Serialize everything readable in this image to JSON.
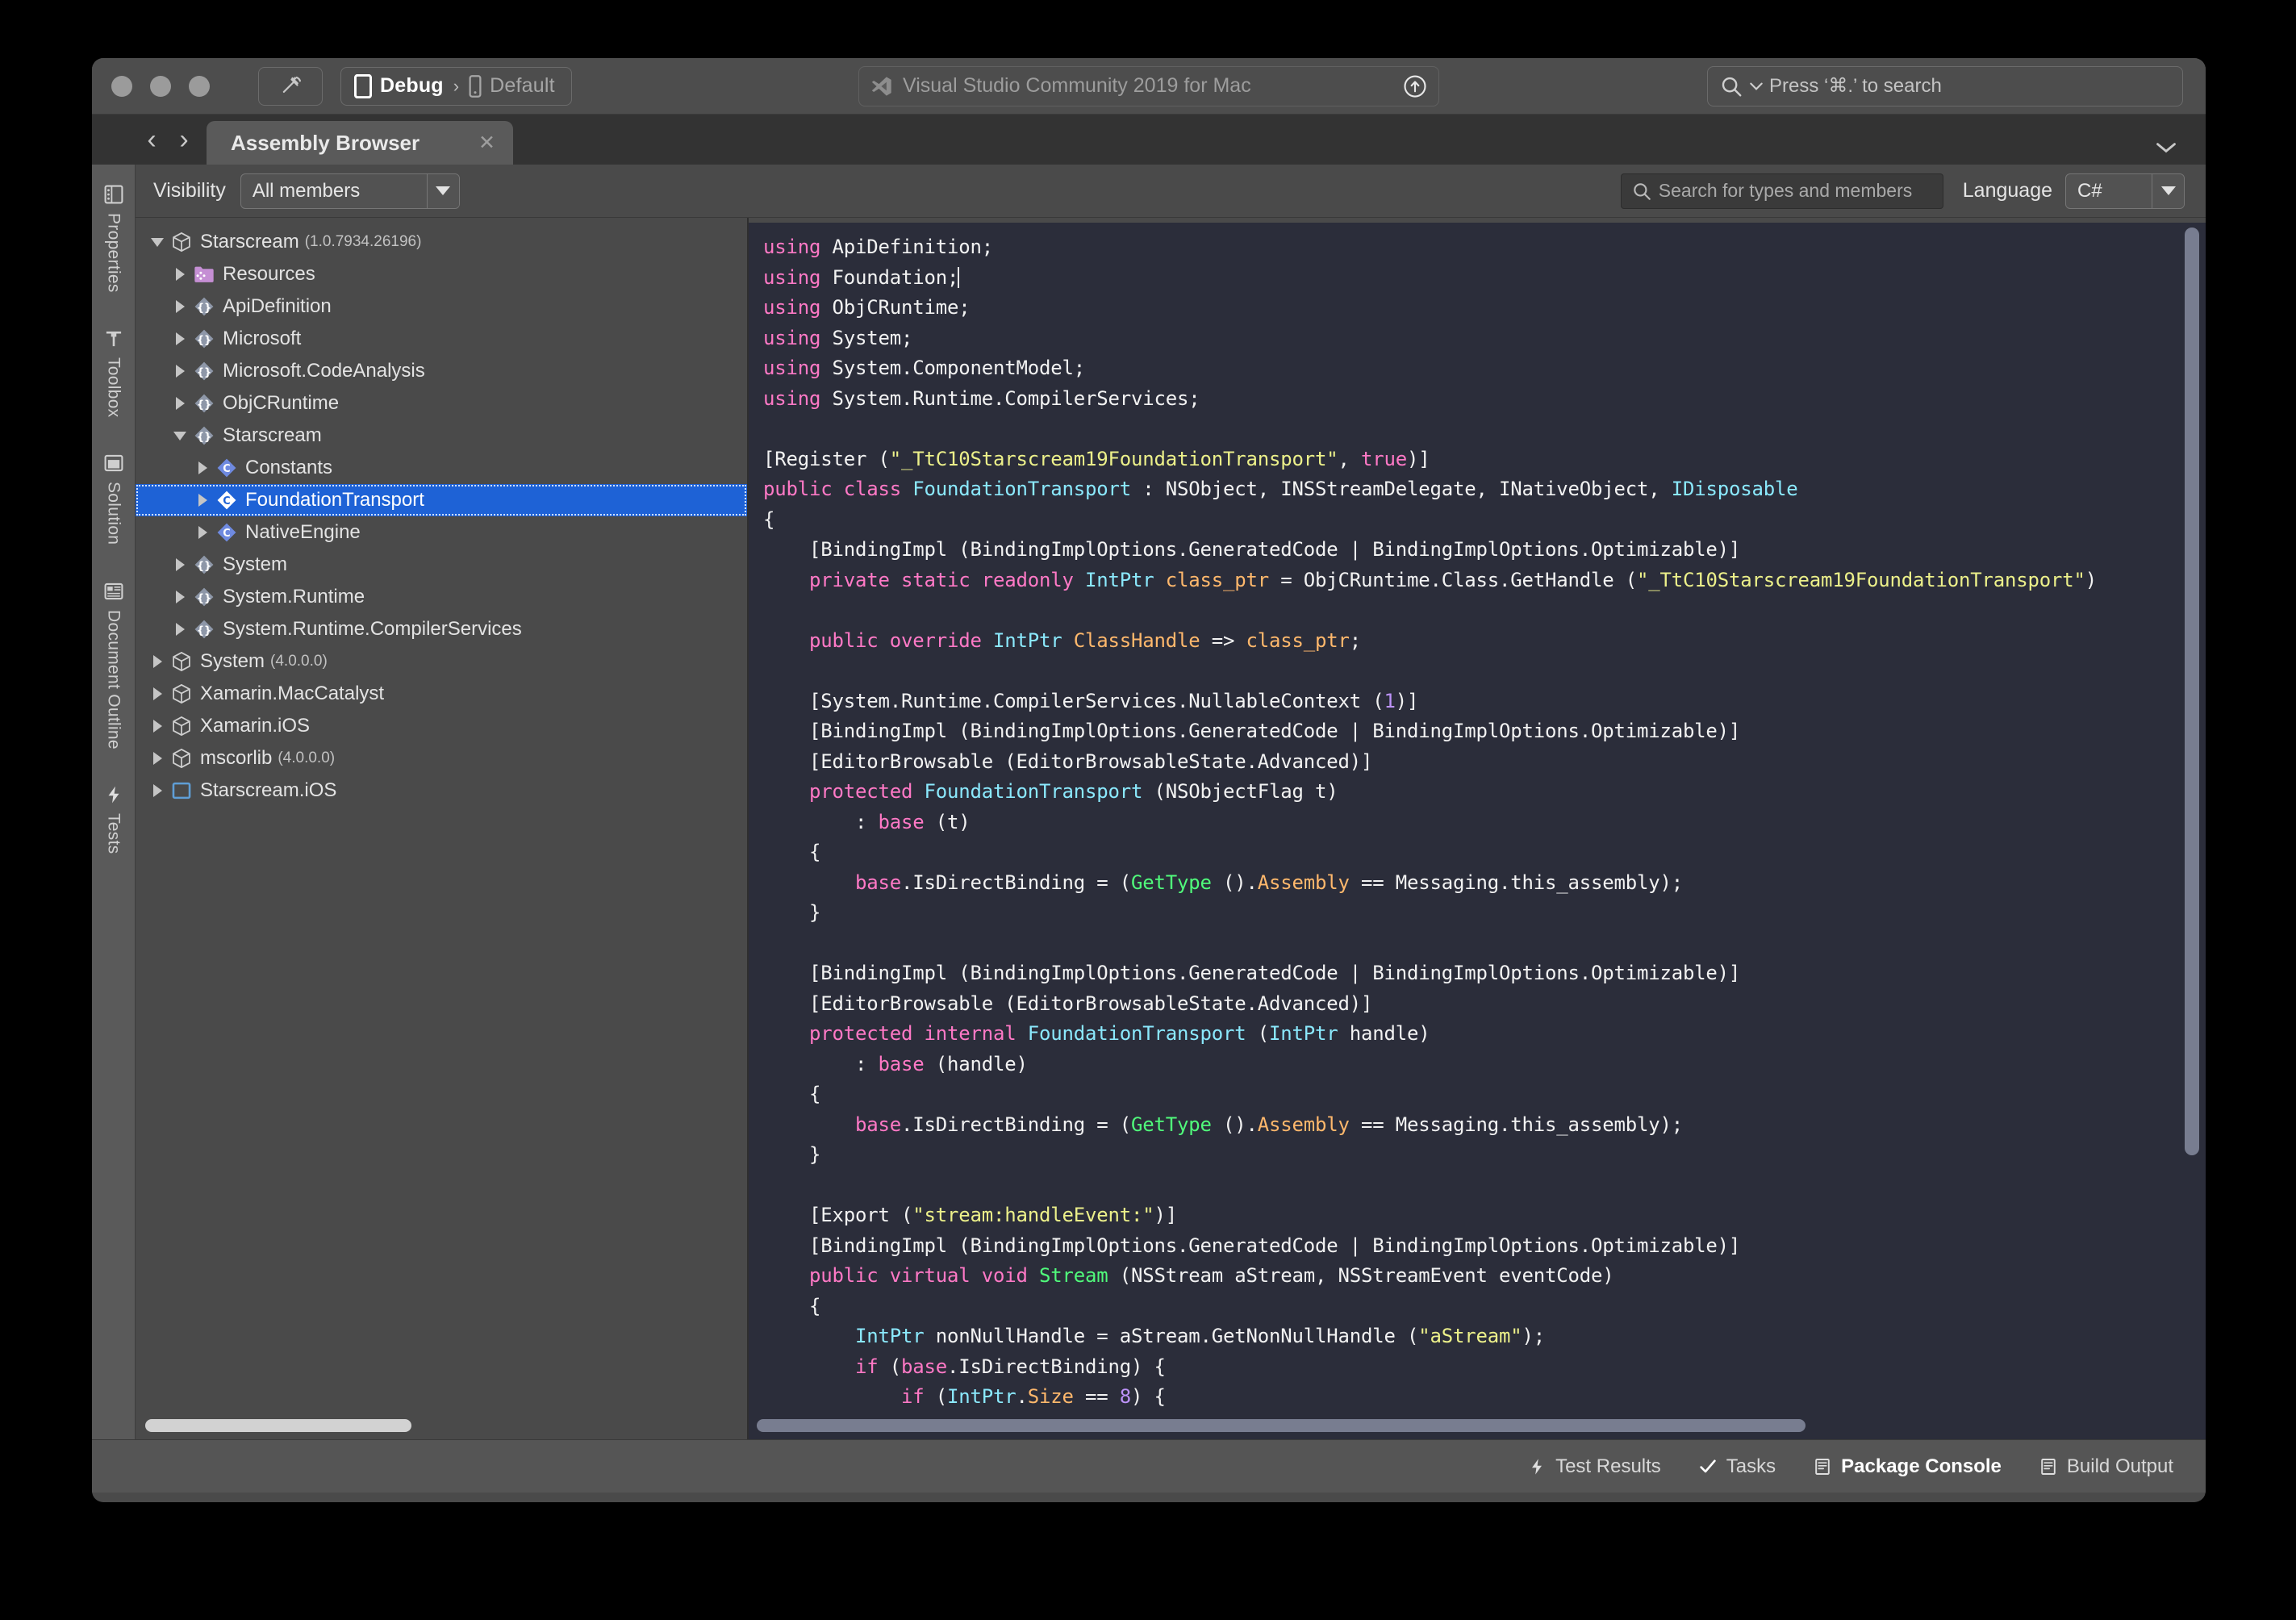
{
  "window": {
    "titlebar": {
      "build_icon": "hammer-icon",
      "configuration": "Debug",
      "config_separator": "›",
      "device": "Default",
      "app_title": "Visual Studio Community 2019 for Mac",
      "app_icon": "visual-studio-icon",
      "update_icon": "update-available-icon",
      "search_placeholder": "Press ‘⌘.’ to search",
      "search_icon": "search-icon"
    },
    "tabstrip": {
      "back_icon": "‹",
      "forward_icon": "›",
      "tab_label": "Assembly Browser",
      "close_icon": "✕",
      "overflow_icon": "chevron-down-icon"
    }
  },
  "padstrip": {
    "items": [
      {
        "label": "Properties",
        "icon": "properties-icon"
      },
      {
        "label": "Toolbox",
        "icon": "toolbox-icon"
      },
      {
        "label": "Solution",
        "icon": "solution-icon"
      },
      {
        "label": "Document Outline",
        "icon": "document-outline-icon"
      },
      {
        "label": "Tests",
        "icon": "tests-icon"
      }
    ]
  },
  "toolbar": {
    "visibility_label": "Visibility",
    "visibility_value": "All members",
    "search_placeholder": "Search for types and members",
    "search_icon": "search-icon",
    "language_label": "Language",
    "language_value": "C#"
  },
  "tree": {
    "nodes": [
      {
        "label": "Starscream",
        "version": "(1.0.7934.26196)",
        "icon": "assembly-icon",
        "twist": "open",
        "indent": 0,
        "selected": false
      },
      {
        "label": "Resources",
        "version": "",
        "icon": "resources-folder-icon",
        "twist": "closed",
        "indent": 1,
        "selected": false
      },
      {
        "label": "ApiDefinition",
        "version": "",
        "icon": "namespace-icon",
        "twist": "closed",
        "indent": 1,
        "selected": false
      },
      {
        "label": "Microsoft",
        "version": "",
        "icon": "namespace-icon",
        "twist": "closed",
        "indent": 1,
        "selected": false
      },
      {
        "label": "Microsoft.CodeAnalysis",
        "version": "",
        "icon": "namespace-icon",
        "twist": "closed",
        "indent": 1,
        "selected": false
      },
      {
        "label": "ObjCRuntime",
        "version": "",
        "icon": "namespace-icon",
        "twist": "closed",
        "indent": 1,
        "selected": false
      },
      {
        "label": "Starscream",
        "version": "",
        "icon": "namespace-icon",
        "twist": "open",
        "indent": 1,
        "selected": false
      },
      {
        "label": "Constants",
        "version": "",
        "icon": "class-icon",
        "twist": "closed",
        "indent": 2,
        "selected": false
      },
      {
        "label": "FoundationTransport",
        "version": "",
        "icon": "class-icon",
        "twist": "closed",
        "indent": 2,
        "selected": true
      },
      {
        "label": "NativeEngine",
        "version": "",
        "icon": "class-icon",
        "twist": "closed",
        "indent": 2,
        "selected": false
      },
      {
        "label": "System",
        "version": "",
        "icon": "namespace-icon",
        "twist": "closed",
        "indent": 1,
        "selected": false
      },
      {
        "label": "System.Runtime",
        "version": "",
        "icon": "namespace-icon",
        "twist": "closed",
        "indent": 1,
        "selected": false
      },
      {
        "label": "System.Runtime.CompilerServices",
        "version": "",
        "icon": "namespace-icon",
        "twist": "closed",
        "indent": 1,
        "selected": false
      },
      {
        "label": "System",
        "version": "(4.0.0.0)",
        "icon": "assembly-icon",
        "twist": "closed",
        "indent": 0,
        "selected": false
      },
      {
        "label": "Xamarin.MacCatalyst",
        "version": "",
        "icon": "assembly-icon",
        "twist": "closed",
        "indent": 0,
        "selected": false
      },
      {
        "label": "Xamarin.iOS",
        "version": "",
        "icon": "assembly-icon",
        "twist": "closed",
        "indent": 0,
        "selected": false
      },
      {
        "label": "mscorlib",
        "version": "(4.0.0.0)",
        "icon": "assembly-icon",
        "twist": "closed",
        "indent": 0,
        "selected": false
      },
      {
        "label": "Starscream.iOS",
        "version": "",
        "icon": "project-icon",
        "twist": "closed",
        "indent": 0,
        "selected": false
      }
    ]
  },
  "editor": {
    "language": "C#",
    "theme_background": "#2b2d3a",
    "colors": {
      "keyword": "#ff79c6",
      "type": "#8be9fd",
      "member": "#ffb86c",
      "string": "#ecf08a",
      "method": "#50fa7b",
      "number": "#bd93f9",
      "plain": "#f2f2f2"
    },
    "lines": [
      [
        {
          "t": "using",
          "c": "k"
        },
        {
          "t": " ApiDefinition;",
          "c": "pl"
        }
      ],
      [
        {
          "t": "using",
          "c": "k"
        },
        {
          "t": " Foundation;",
          "c": "pl"
        },
        {
          "t": "|caret|",
          "c": "caret"
        }
      ],
      [
        {
          "t": "using",
          "c": "k"
        },
        {
          "t": " ObjCRuntime;",
          "c": "pl"
        }
      ],
      [
        {
          "t": "using",
          "c": "k"
        },
        {
          "t": " System;",
          "c": "pl"
        }
      ],
      [
        {
          "t": "using",
          "c": "k"
        },
        {
          "t": " System.ComponentModel;",
          "c": "pl"
        }
      ],
      [
        {
          "t": "using",
          "c": "k"
        },
        {
          "t": " System.Runtime.CompilerServices;",
          "c": "pl"
        }
      ],
      [],
      [
        {
          "t": "[Register (",
          "c": "pl"
        },
        {
          "t": "\"_TtC10Starscream19FoundationTransport\"",
          "c": "st"
        },
        {
          "t": ", ",
          "c": "pl"
        },
        {
          "t": "true",
          "c": "k"
        },
        {
          "t": ")]",
          "c": "pl"
        }
      ],
      [
        {
          "t": "public class",
          "c": "k"
        },
        {
          "t": " ",
          "c": "pl"
        },
        {
          "t": "FoundationTransport",
          "c": "ty"
        },
        {
          "t": " : NSObject, INSStreamDelegate, INativeObject, ",
          "c": "pl"
        },
        {
          "t": "IDisposable",
          "c": "ty"
        }
      ],
      [
        {
          "t": "{",
          "c": "pl"
        }
      ],
      [
        {
          "t": "    [BindingImpl (BindingImplOptions.GeneratedCode | BindingImplOptions.Optimizable)]",
          "c": "pl"
        }
      ],
      [
        {
          "t": "    ",
          "c": "pl"
        },
        {
          "t": "private static readonly",
          "c": "k"
        },
        {
          "t": " ",
          "c": "pl"
        },
        {
          "t": "IntPtr",
          "c": "ty"
        },
        {
          "t": " ",
          "c": "pl"
        },
        {
          "t": "class_ptr",
          "c": "id"
        },
        {
          "t": " = ObjCRuntime.Class.GetHandle (",
          "c": "pl"
        },
        {
          "t": "\"_TtC10Starscream19FoundationTransport\"",
          "c": "st"
        },
        {
          "t": ")",
          "c": "pl"
        }
      ],
      [],
      [
        {
          "t": "    ",
          "c": "pl"
        },
        {
          "t": "public override",
          "c": "k"
        },
        {
          "t": " ",
          "c": "pl"
        },
        {
          "t": "IntPtr",
          "c": "ty"
        },
        {
          "t": " ",
          "c": "pl"
        },
        {
          "t": "ClassHandle",
          "c": "id"
        },
        {
          "t": " => ",
          "c": "pl"
        },
        {
          "t": "class_ptr",
          "c": "id"
        },
        {
          "t": ";",
          "c": "pl"
        }
      ],
      [],
      [
        {
          "t": "    [System.Runtime.CompilerServices.NullableContext (",
          "c": "pl"
        },
        {
          "t": "1",
          "c": "nm"
        },
        {
          "t": ")]",
          "c": "pl"
        }
      ],
      [
        {
          "t": "    [BindingImpl (BindingImplOptions.GeneratedCode | BindingImplOptions.Optimizable)]",
          "c": "pl"
        }
      ],
      [
        {
          "t": "    [EditorBrowsable (EditorBrowsableState.Advanced)]",
          "c": "pl"
        }
      ],
      [
        {
          "t": "    ",
          "c": "pl"
        },
        {
          "t": "protected",
          "c": "k"
        },
        {
          "t": " ",
          "c": "pl"
        },
        {
          "t": "FoundationTransport",
          "c": "ty"
        },
        {
          "t": " (NSObjectFlag t)",
          "c": "pl"
        }
      ],
      [
        {
          "t": "        : ",
          "c": "pl"
        },
        {
          "t": "base",
          "c": "k"
        },
        {
          "t": " (t)",
          "c": "pl"
        }
      ],
      [
        {
          "t": "    {",
          "c": "pl"
        }
      ],
      [
        {
          "t": "        ",
          "c": "pl"
        },
        {
          "t": "base",
          "c": "k"
        },
        {
          "t": ".IsDirectBinding = (",
          "c": "pl"
        },
        {
          "t": "GetType",
          "c": "fn"
        },
        {
          "t": " ().",
          "c": "pl"
        },
        {
          "t": "Assembly",
          "c": "id"
        },
        {
          "t": " == Messaging.this_assembly);",
          "c": "pl"
        }
      ],
      [
        {
          "t": "    }",
          "c": "pl"
        }
      ],
      [],
      [
        {
          "t": "    [BindingImpl (BindingImplOptions.GeneratedCode | BindingImplOptions.Optimizable)]",
          "c": "pl"
        }
      ],
      [
        {
          "t": "    [EditorBrowsable (EditorBrowsableState.Advanced)]",
          "c": "pl"
        }
      ],
      [
        {
          "t": "    ",
          "c": "pl"
        },
        {
          "t": "protected internal",
          "c": "k"
        },
        {
          "t": " ",
          "c": "pl"
        },
        {
          "t": "FoundationTransport",
          "c": "ty"
        },
        {
          "t": " (",
          "c": "pl"
        },
        {
          "t": "IntPtr",
          "c": "ty"
        },
        {
          "t": " handle)",
          "c": "pl"
        }
      ],
      [
        {
          "t": "        : ",
          "c": "pl"
        },
        {
          "t": "base",
          "c": "k"
        },
        {
          "t": " (handle)",
          "c": "pl"
        }
      ],
      [
        {
          "t": "    {",
          "c": "pl"
        }
      ],
      [
        {
          "t": "        ",
          "c": "pl"
        },
        {
          "t": "base",
          "c": "k"
        },
        {
          "t": ".IsDirectBinding = (",
          "c": "pl"
        },
        {
          "t": "GetType",
          "c": "fn"
        },
        {
          "t": " ().",
          "c": "pl"
        },
        {
          "t": "Assembly",
          "c": "id"
        },
        {
          "t": " == Messaging.this_assembly);",
          "c": "pl"
        }
      ],
      [
        {
          "t": "    }",
          "c": "pl"
        }
      ],
      [],
      [
        {
          "t": "    [Export (",
          "c": "pl"
        },
        {
          "t": "\"stream:handleEvent:\"",
          "c": "st"
        },
        {
          "t": ")]",
          "c": "pl"
        }
      ],
      [
        {
          "t": "    [BindingImpl (BindingImplOptions.GeneratedCode | BindingImplOptions.Optimizable)]",
          "c": "pl"
        }
      ],
      [
        {
          "t": "    ",
          "c": "pl"
        },
        {
          "t": "public virtual void",
          "c": "k"
        },
        {
          "t": " ",
          "c": "pl"
        },
        {
          "t": "Stream",
          "c": "fn"
        },
        {
          "t": " (NSStream aStream, NSStreamEvent eventCode)",
          "c": "pl"
        }
      ],
      [
        {
          "t": "    {",
          "c": "pl"
        }
      ],
      [
        {
          "t": "        ",
          "c": "pl"
        },
        {
          "t": "IntPtr",
          "c": "ty"
        },
        {
          "t": " nonNullHandle = aStream.GetNonNullHandle (",
          "c": "pl"
        },
        {
          "t": "\"aStream\"",
          "c": "st"
        },
        {
          "t": ");",
          "c": "pl"
        }
      ],
      [
        {
          "t": "        ",
          "c": "pl"
        },
        {
          "t": "if",
          "c": "k"
        },
        {
          "t": " (",
          "c": "pl"
        },
        {
          "t": "base",
          "c": "k"
        },
        {
          "t": ".IsDirectBinding) {",
          "c": "pl"
        }
      ],
      [
        {
          "t": "            ",
          "c": "pl"
        },
        {
          "t": "if",
          "c": "k"
        },
        {
          "t": " (",
          "c": "pl"
        },
        {
          "t": "IntPtr",
          "c": "ty"
        },
        {
          "t": ".",
          "c": "pl"
        },
        {
          "t": "Size",
          "c": "id"
        },
        {
          "t": " == ",
          "c": "pl"
        },
        {
          "t": "8",
          "c": "nm"
        },
        {
          "t": ") {",
          "c": "pl"
        }
      ]
    ]
  },
  "statusbar": {
    "items": [
      {
        "label": "Test Results",
        "icon": "bolt-icon",
        "bold": false
      },
      {
        "label": "Tasks",
        "icon": "check-icon",
        "bold": false
      },
      {
        "label": "Package Console",
        "icon": "console-icon",
        "bold": true
      },
      {
        "label": "Build Output",
        "icon": "console-icon",
        "bold": false
      }
    ]
  }
}
